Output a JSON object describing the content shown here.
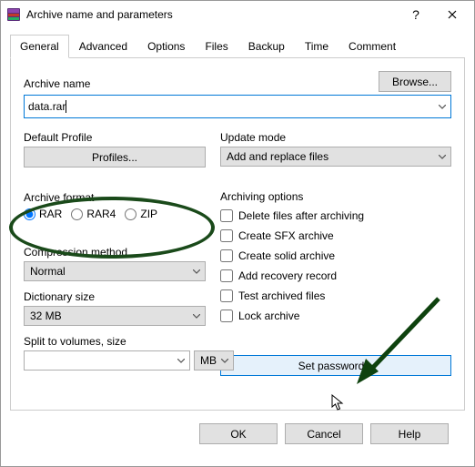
{
  "window": {
    "title": "Archive name and parameters"
  },
  "tabs": {
    "items": [
      "General",
      "Advanced",
      "Options",
      "Files",
      "Backup",
      "Time",
      "Comment"
    ],
    "active": 0
  },
  "browse_label": "Browse...",
  "archive_name": {
    "label": "Archive name",
    "value": "data.rar"
  },
  "default_profile": {
    "label": "Default Profile",
    "button": "Profiles..."
  },
  "update_mode": {
    "label": "Update mode",
    "value": "Add and replace files"
  },
  "archive_format": {
    "label": "Archive format",
    "options": [
      "RAR",
      "RAR4",
      "ZIP"
    ],
    "selected": "RAR"
  },
  "compression": {
    "label": "Compression method",
    "value": "Normal"
  },
  "dictionary": {
    "label": "Dictionary size",
    "value": "32 MB"
  },
  "split": {
    "label": "Split to volumes, size",
    "value": "",
    "unit": "MB"
  },
  "archiving_options": {
    "label": "Archiving options",
    "items": [
      {
        "label": "Delete files after archiving",
        "checked": false
      },
      {
        "label": "Create SFX archive",
        "checked": false
      },
      {
        "label": "Create solid archive",
        "checked": false
      },
      {
        "label": "Add recovery record",
        "checked": false
      },
      {
        "label": "Test archived files",
        "checked": false
      },
      {
        "label": "Lock archive",
        "checked": false
      }
    ]
  },
  "set_password_label": "Set password...",
  "footer": {
    "ok": "OK",
    "cancel": "Cancel",
    "help": "Help"
  }
}
